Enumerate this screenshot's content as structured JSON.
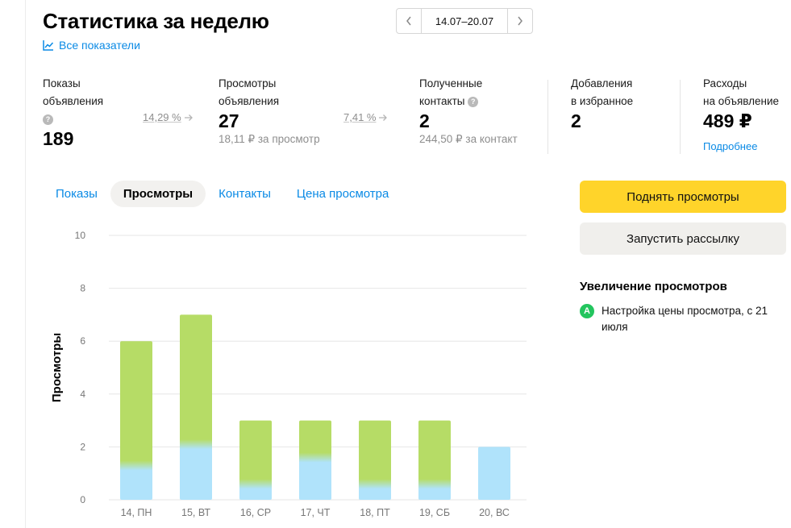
{
  "header": {
    "title": "Статистика за неделю",
    "all_metrics_link": "Все показатели",
    "date_range": "14.07–20.07"
  },
  "metrics": {
    "impressions": {
      "label_line1": "Показы",
      "label_line2": "объявления",
      "value": "189"
    },
    "conv1": "14,29 %",
    "views": {
      "label_line1": "Просмотры",
      "label_line2": "объявления",
      "value": "27",
      "sub": "18,11 ₽ за просмотр"
    },
    "conv2": "7,41 %",
    "contacts": {
      "label_line1": "Полученные",
      "label_line2": "контакты",
      "value": "2",
      "sub": "244,50 ₽ за контакт"
    },
    "favorites": {
      "label_line1": "Добавления",
      "label_line2": "в избранное",
      "value": "2"
    },
    "expenses": {
      "label_line1": "Расходы",
      "label_line2": "на объявление",
      "value": "489 ₽",
      "link": "Подробнее"
    }
  },
  "tabs": [
    {
      "label": "Показы",
      "active": false
    },
    {
      "label": "Просмотры",
      "active": true
    },
    {
      "label": "Контакты",
      "active": false
    },
    {
      "label": "Цена просмотра",
      "active": false
    }
  ],
  "actions": {
    "raise_views": "Поднять просмотры",
    "start_mailing": "Запустить рассылку"
  },
  "boost": {
    "title": "Увеличение просмотров",
    "item_badge": "A",
    "item_text": "Настройка цены просмотра, с 21 июля"
  },
  "colors": {
    "accent_link": "#0a8ae5",
    "button_yellow": "#ffd42a",
    "bar_green": "#b6dc66",
    "bar_blue": "#b0e3fb",
    "badge_green": "#23c55e"
  },
  "chart_data": {
    "type": "bar",
    "stacked": true,
    "categories": [
      "14, ПН",
      "15, ВТ",
      "16, СР",
      "17, ЧТ",
      "18, ПТ",
      "19, СБ",
      "20, ВС"
    ],
    "series": [
      {
        "values": [
          1.3,
          2.1,
          0.6,
          1.6,
          0.6,
          0.6,
          2
        ]
      },
      {
        "values": [
          4.7,
          4.9,
          2.4,
          1.4,
          2.4,
          2.4,
          0
        ]
      }
    ],
    "ylabel": "Просмотры",
    "ylim": [
      0,
      10
    ],
    "yticks": [
      0,
      2,
      4,
      6,
      8,
      10
    ],
    "grid": true
  }
}
